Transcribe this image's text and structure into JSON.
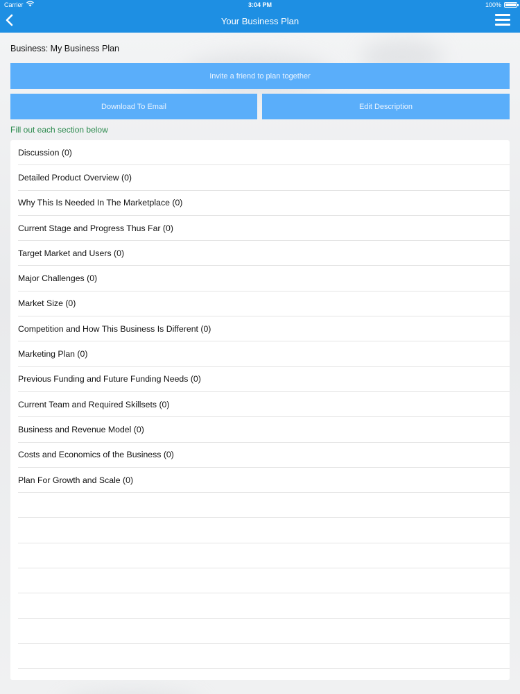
{
  "status_bar": {
    "carrier": "Carrier",
    "time": "3:04 PM",
    "battery": "100%"
  },
  "nav": {
    "title": "Your Business Plan",
    "back_icon": "chevron-left-icon",
    "menu_icon": "hamburger-menu-icon"
  },
  "business_label": "Business: My Business Plan",
  "buttons": {
    "invite": "Invite a friend to plan together",
    "download": "Download To Email",
    "edit": "Edit Description"
  },
  "hint": "Fill out each section below",
  "sections": [
    "Discussion (0)",
    "Detailed Product Overview (0)",
    "Why This Is Needed In The Marketplace (0)",
    "Current Stage and Progress Thus Far (0)",
    "Target Market and Users (0)",
    "Major Challenges (0)",
    "Market Size (0)",
    "Competition and How This Business Is Different (0)",
    "Marketing Plan (0)",
    "Previous Funding and Future Funding Needs (0)",
    "Current Team and Required Skillsets (0)",
    "Business and Revenue Model (0)",
    "Costs and Economics of the Business (0)",
    "Plan For Growth and Scale (0)"
  ],
  "colors": {
    "nav_bar": "#1e8fe3",
    "button": "#5aaefa",
    "hint_text": "#2c8a4e"
  }
}
